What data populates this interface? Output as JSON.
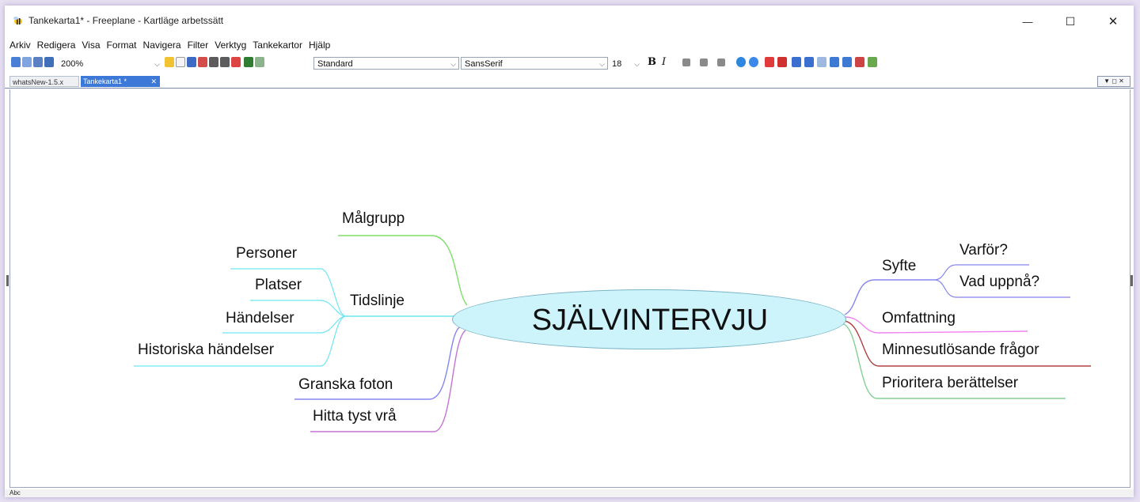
{
  "window": {
    "title": "Tankekarta1* - Freeplane - Kartläge arbetssätt",
    "controls": {
      "minimize": "—",
      "maximize": "☐",
      "close": "✕"
    }
  },
  "menu": [
    "Arkiv",
    "Redigera",
    "Visa",
    "Format",
    "Navigera",
    "Filter",
    "Verktyg",
    "Tankekartor",
    "Hjälp"
  ],
  "toolbar": {
    "zoom": "200%",
    "style": "Standard",
    "font": "SansSerif",
    "size": "18",
    "bold": "B",
    "italic": "I"
  },
  "tabs": [
    {
      "label": "whatsNew-1.5.x",
      "active": false
    },
    {
      "label": "Tankekarta1 *",
      "active": true
    }
  ],
  "panel_controls": "▼ ◻ ✕",
  "mindmap": {
    "root": "SJÄLVINTERVJU",
    "left": {
      "malgrupp": "Målgrupp",
      "tidslinje": "Tidslinje",
      "tidslinje_children": [
        "Personer",
        "Platser",
        "Händelser",
        "Historiska händelser"
      ],
      "granska": "Granska foton",
      "hitta": "Hitta tyst vrå"
    },
    "right": {
      "syfte": "Syfte",
      "syfte_children": [
        "Varför?",
        "Vad uppnå?"
      ],
      "omfattning": "Omfattning",
      "minnes": "Minnesutlösande frågor",
      "prioritera": "Prioritera berättelser"
    },
    "colors": {
      "green": "#7ddf6a",
      "cyan": "#6ee6f2",
      "blue": "#8585ee",
      "purple": "#c275d3",
      "pink": "#f07ff0",
      "red": "#b04242",
      "lightgreen": "#84cf94"
    }
  },
  "status": "Abc"
}
